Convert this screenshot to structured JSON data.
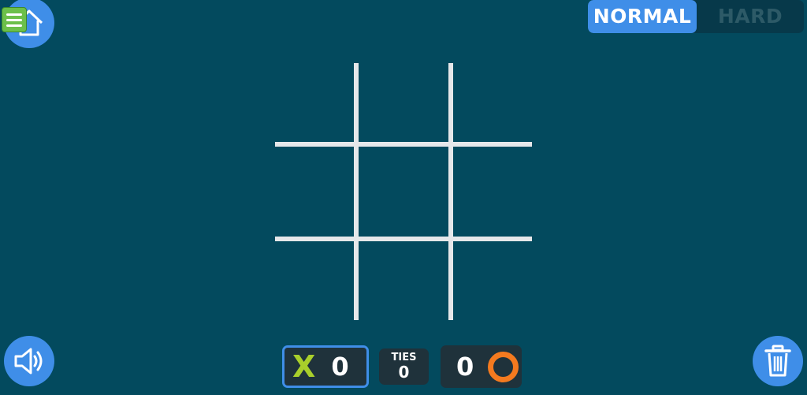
{
  "mode_switch": {
    "normal_label": "NORMAL",
    "hard_label": "HARD",
    "selected": "NORMAL"
  },
  "scoreboard": {
    "x": {
      "mark": "X",
      "score": "0"
    },
    "ties": {
      "label": "TIES",
      "count": "0"
    },
    "o": {
      "score": "0"
    }
  },
  "board": {
    "cells": [
      "",
      "",
      "",
      "",
      "",
      "",
      "",
      "",
      ""
    ]
  },
  "icons": {
    "home": "home-icon",
    "menu": "menu-icon",
    "sound": "speaker-icon",
    "trash": "trash-icon"
  },
  "colors": {
    "background": "#034a5e",
    "accent": "#3f8ee8",
    "x_mark": "#a9cf2b",
    "o_mark": "#f47a1f",
    "grid": "#e6e8ea"
  }
}
